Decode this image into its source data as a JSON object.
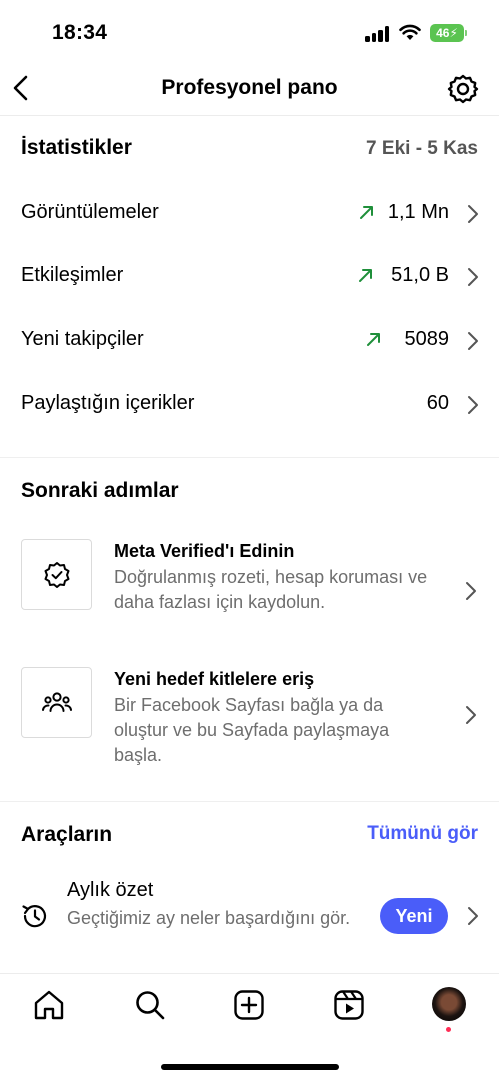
{
  "status_bar": {
    "time": "18:34",
    "battery": "46"
  },
  "nav": {
    "title": "Profesyonel pano"
  },
  "stats": {
    "title": "İstatistikler",
    "date_range": "7 Eki - 5 Kas",
    "rows": [
      {
        "label": "Görüntülemeler",
        "value": "1,1 Mn",
        "trend": "up"
      },
      {
        "label": "Etkileşimler",
        "value": "51,0 B",
        "trend": "up"
      },
      {
        "label": "Yeni takipçiler",
        "value": "5089",
        "trend": "up"
      },
      {
        "label": "Paylaştığın içerikler",
        "value": "60",
        "trend": "none"
      }
    ],
    "trend_color": "#1f8f3a"
  },
  "next_steps": {
    "title": "Sonraki adımlar",
    "items": [
      {
        "title": "Meta Verified'ı Edinin",
        "description": "Doğrulanmış rozeti, hesap koruması ve daha fazlası için kaydolun.",
        "icon": "verified-badge-icon"
      },
      {
        "title": "Yeni hedef kitlelere eriş",
        "description": "Bir Facebook Sayfası bağla ya da oluştur ve bu Sayfada paylaşmaya başla.",
        "icon": "audience-icon"
      }
    ]
  },
  "tools": {
    "title": "Araçların",
    "see_all": "Tümünü gör",
    "accent": "#4a5df9",
    "items": [
      {
        "title": "Aylık özet",
        "description": "Geçtiğimiz ay neler başardığını gör.",
        "badge": "Yeni",
        "icon": "history-icon"
      }
    ]
  },
  "tabbar": {
    "items": [
      "home-icon",
      "search-icon",
      "create-icon",
      "reels-icon",
      "profile-avatar"
    ]
  }
}
